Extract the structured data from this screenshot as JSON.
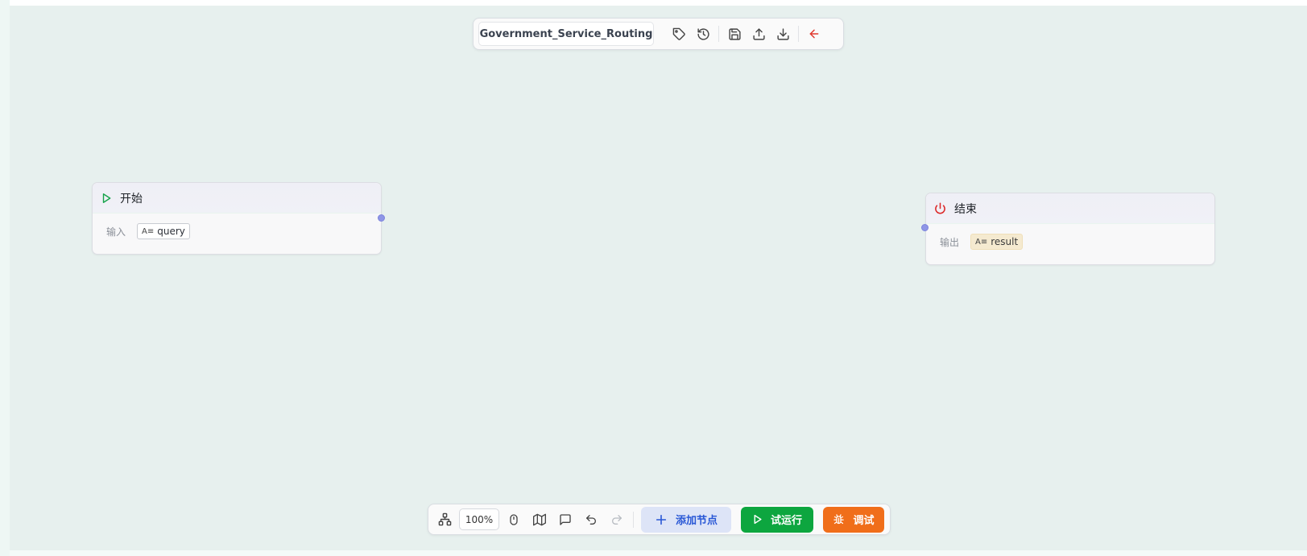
{
  "toolbar": {
    "workflow_name": "Government_Service_Routing",
    "icons": [
      "tag-icon",
      "history-icon",
      "save-icon",
      "upload-icon",
      "download-icon",
      "back-arrow-icon"
    ]
  },
  "nodes": {
    "start": {
      "title": "开始",
      "label": "输入",
      "variable": "query",
      "icon": "play-icon"
    },
    "end": {
      "title": "结束",
      "label": "输出",
      "variable": "result",
      "icon": "power-icon"
    }
  },
  "bottom_toolbar": {
    "zoom": "100%",
    "add_node_label": "添加节点",
    "test_run_label": "试运行",
    "debug_label": "调试",
    "icons": [
      "layout-icon",
      "mouse-icon",
      "map-icon",
      "comment-icon",
      "undo-icon",
      "redo-icon"
    ]
  },
  "colors": {
    "canvas": "#e7f0ee",
    "handle": "#8f96e6",
    "start_icon": "#16a34a",
    "end_icon": "#dc2626",
    "add_node_bg": "#dde4f7",
    "test_run_bg": "#0da63f",
    "debug_bg": "#f06e1a",
    "back_arrow": "#e0382c"
  }
}
